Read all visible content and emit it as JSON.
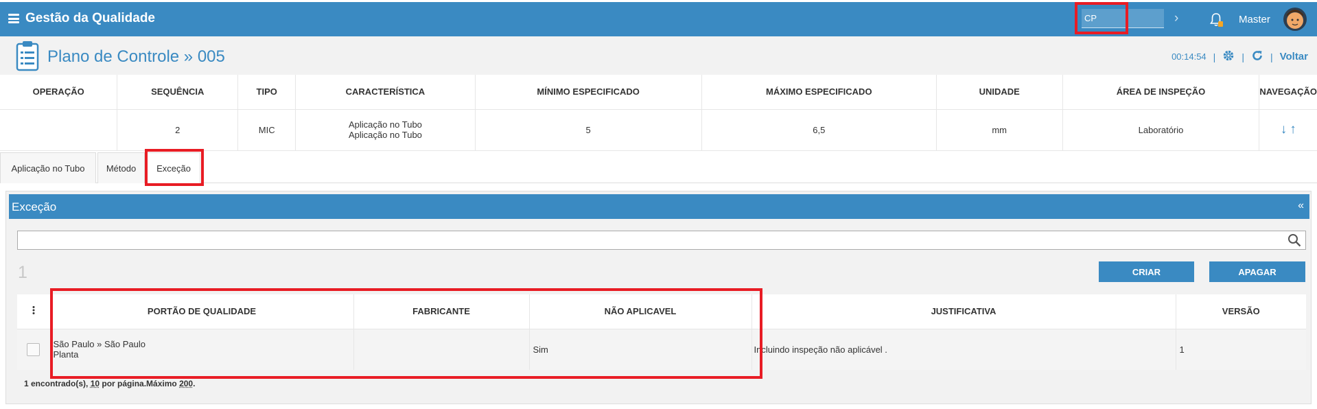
{
  "header": {
    "app_title": "Gestão da Qualidade",
    "cp_value": "CP",
    "user_name": "Master"
  },
  "page": {
    "title": "Plano de Controle » 005",
    "timer": "00:14:54",
    "back_label": "Voltar"
  },
  "spec": {
    "columns": [
      "OPERAÇÃO",
      "SEQUÊNCIA",
      "TIPO",
      "CARACTERÍSTICA",
      "MÍNIMO ESPECIFICADO",
      "MÁXIMO ESPECIFICADO",
      "UNIDADE",
      "ÁREA DE INSPEÇÃO",
      "NAVEGAÇÃO"
    ],
    "row": {
      "operacao": "",
      "sequencia": "2",
      "tipo": "MIC",
      "caracteristica_1": "Aplicação no Tubo",
      "caracteristica_2": "Aplicação no Tubo",
      "minimo": "5",
      "maximo": "6,5",
      "unidade": "mm",
      "area": "Laboratório"
    }
  },
  "tabs": [
    "Aplicação no Tubo",
    "Método",
    "Exceção"
  ],
  "panel": {
    "title": "Exceção",
    "collapse_label": "«",
    "count": "1",
    "create_label": "CRIAR",
    "delete_label": "APAGAR",
    "columns": [
      "PORTÃO DE QUALIDADE",
      "FABRICANTE",
      "NÃO APLICAVEL",
      "JUSTIFICATIVA",
      "VERSÃO"
    ],
    "row": {
      "portao_1": "São Paulo » São Paulo",
      "portao_2": "Planta",
      "fabricante": "",
      "nao_aplicavel": "Sim",
      "justificativa": "Incluindo inspeção não aplicável .",
      "versao": "1"
    },
    "footer": {
      "prefix": "1 encontrado(s), ",
      "per_page": "10",
      "mid": " por página.Máximo ",
      "max": "200",
      "suffix": "."
    }
  },
  "colors": {
    "primary": "#3a8ac2",
    "highlight": "#e81c24"
  },
  "icons": [
    "menu-icon",
    "bell-icon",
    "chevron-right-icon",
    "clipboard-icon",
    "gear-icon",
    "refresh-icon",
    "arrow-down-icon",
    "arrow-up-icon",
    "search-icon",
    "kebab-icon"
  ]
}
